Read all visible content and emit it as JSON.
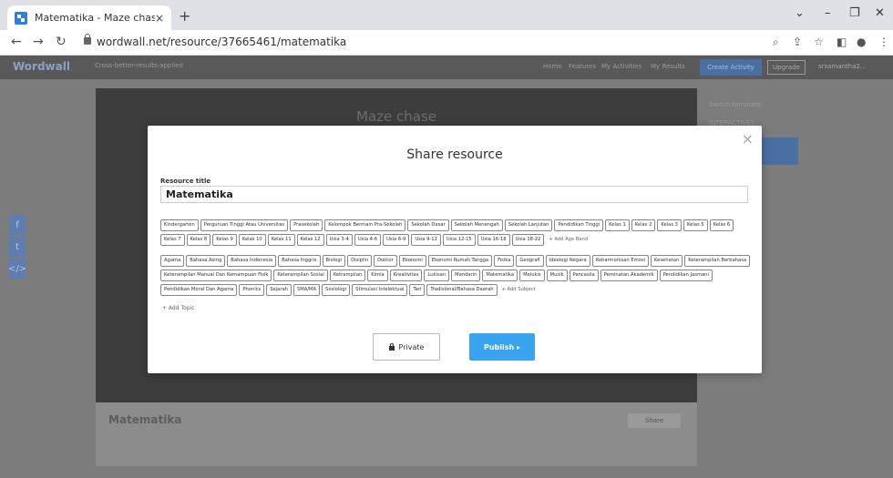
{
  "browser": {
    "tab_title": "Matematika - Maze chase",
    "tab_close": "×",
    "new_tab": "+",
    "url": "wordwall.net/resource/37665461/matematika"
  },
  "site": {
    "logo": "Wordwall",
    "search_hint": "Cross-better-results-applied",
    "nav": [
      "Home",
      "Features",
      "My Activities",
      "My Results"
    ],
    "create_activity": "Create Activity",
    "upgrade": "Upgrade",
    "user": "srsamantha2..."
  },
  "game": {
    "title": "Maze chase"
  },
  "right_panel": {
    "switch_template": "Switch template",
    "interactives": "INTERACTIVES"
  },
  "bottom_info": {
    "title": "Matematika",
    "share": "Share"
  },
  "modal": {
    "title": "Share resource",
    "close": "×",
    "resource_title_label": "Resource title",
    "resource_title_value": "Matematika",
    "age_bands": [
      "Kindergarten",
      "Perguruan Tinggi Atau Universitas",
      "Prasekolah",
      "Kelompok Bermain Pra-Sekolah",
      "Sekolah Dasar",
      "Sekolah Menengah",
      "Sekolah Lanjutan",
      "Pendidikan Tinggi",
      "Kelas 1",
      "Kelas 2",
      "Kelas 3",
      "Kelas 5",
      "Kelas 6",
      "Kelas 7",
      "Kelas 8",
      "Kelas 9",
      "Kelas 10",
      "Kelas 11",
      "Kelas 12",
      "Usia 3-4",
      "Usia 4-6",
      "Usia 6-9",
      "Usia 9-12",
      "Usia 12-15",
      "Usia 16-18",
      "Usia 18-22"
    ],
    "add_age_band": "+ Add Age Band",
    "subjects": [
      "Agama",
      "Bahasa Asing",
      "Bahasa Indonesia",
      "Bahasa Inggris",
      "Biologi",
      "Disiplin",
      "Doktor",
      "Ekonomi",
      "Ekonomi Rumah Tangga",
      "Fisika",
      "Geografi",
      "Ideologi Negara",
      "Keharmonisan Emosi",
      "Kesehatan",
      "Keterampilan Berbahasa",
      "Keterampilan Manual Dan Kemampuan Fisik",
      "Keterampilan Sosial",
      "Ketrampilan",
      "Kimia",
      "Kreativitas",
      "Lukisan",
      "Mandarin",
      "Matematika",
      "Melukis",
      "Musik",
      "Pancasila",
      "Peminatan Akademik",
      "Pendidikan Jasmani",
      "Pendidikan Moral Dan Agama",
      "Phonics",
      "Sejarah",
      "SMA/MA",
      "Sosiologi",
      "Stimulasi Intelektual",
      "Tari",
      "Tradisional/Bahasa Daerah"
    ],
    "add_subject": "+ Add Subject",
    "add_topic": "+ Add Topic",
    "private_label": "Private",
    "publish_label": "Publish ▸"
  },
  "colors": {
    "publish": "#39a4f0",
    "overlay": "#7c7c7c"
  }
}
